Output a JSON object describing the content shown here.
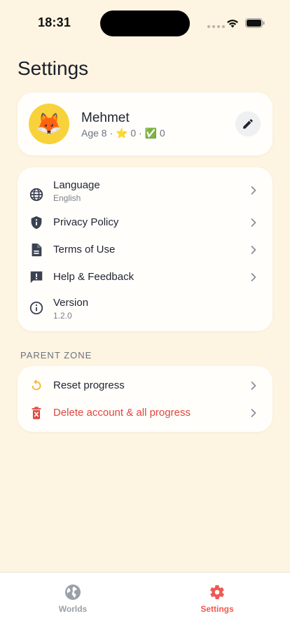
{
  "status_bar": {
    "time": "18:31"
  },
  "page": {
    "title": "Settings"
  },
  "profile": {
    "avatar_emoji": "🦊",
    "name": "Mehmet",
    "meta": "Age 8 · ⭐ 0 · ✅ 0"
  },
  "menu": {
    "items": [
      {
        "label": "Language",
        "sublabel": "English",
        "icon": "globe-icon"
      },
      {
        "label": "Privacy Policy",
        "icon": "shield-icon"
      },
      {
        "label": "Terms of Use",
        "icon": "document-icon"
      },
      {
        "label": "Help & Feedback",
        "icon": "feedback-icon"
      },
      {
        "label": "Version",
        "sublabel": "1.2.0",
        "icon": "info-icon"
      }
    ]
  },
  "parent_zone": {
    "header": "PARENT ZONE",
    "items": [
      {
        "label": "Reset progress",
        "icon": "reset-icon"
      },
      {
        "label": "Delete account & all progress",
        "icon": "trash-icon"
      }
    ]
  },
  "tab_bar": {
    "tabs": [
      {
        "label": "Worlds",
        "icon": "globe-icon",
        "active": false
      },
      {
        "label": "Settings",
        "icon": "gear-icon",
        "active": true
      }
    ]
  },
  "colors": {
    "background": "#fdf4e1",
    "accent": "#ee5a52",
    "danger": "#e0453f",
    "reset_icon": "#f2b72c",
    "icon": "#3a4150"
  }
}
